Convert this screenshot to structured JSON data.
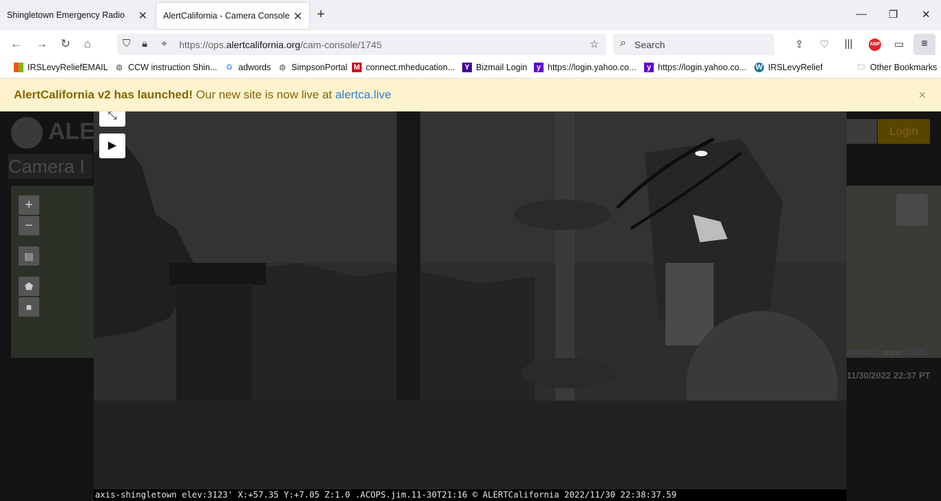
{
  "tabs": [
    {
      "label": "Shingletown Emergency Radio",
      "active": false
    },
    {
      "label": "AlertCalifornia - Camera Console",
      "active": true
    }
  ],
  "address": {
    "prefix": "https://ops.",
    "domain": "alertcalifornia.org",
    "path": "/cam-console/1745"
  },
  "search": {
    "placeholder": "Search"
  },
  "bookmarks": [
    {
      "label": "IRSLevyReliefEMAIL",
      "icon": "windows-icon"
    },
    {
      "label": "CCW instruction Shin...",
      "icon": "globe-icon"
    },
    {
      "label": "adwords",
      "icon": "google-icon"
    },
    {
      "label": "SimpsonPortal",
      "icon": "globe-icon"
    },
    {
      "label": "connect.mheducation...",
      "icon": "mcgraw-hill-icon"
    },
    {
      "label": "Bizmail Login",
      "icon": "yahoo-icon"
    },
    {
      "label": "https://login.yahoo.co...",
      "icon": "yahoo-icon"
    },
    {
      "label": "https://login.yahoo.co...",
      "icon": "yahoo-icon"
    },
    {
      "label": "IRSLevyRelief",
      "icon": "wordpress-icon"
    }
  ],
  "other_bookmarks": "Other Bookmarks",
  "extension_badge": "ABP",
  "banner": {
    "bold": "AlertCalifornia v2 has launched!",
    "text": " Our new site is now live at ",
    "link": "alertca.live",
    "close": "×"
  },
  "background_page": {
    "logo_text": "ALE",
    "heading": "Camera I",
    "login": "Login",
    "map_attribution_link": "reetMap",
    "map_attribution_text": ", under ",
    "map_attribution_link2": "ODbL.",
    "timestamp": "11/30/2022 22:37 PT"
  },
  "camera": {
    "caption": "axis-shingletown elev:3123' X:+57.35 Y:+7.05 Z:1.0 .ACOPS.jim.11-30T21:16 © ALERTCalifornia 2022/11/30 22:38:37.59"
  },
  "colors": {
    "banner_bg": "#fff3cd",
    "banner_text": "#856404",
    "link": "#2f7fd4",
    "abp": "#e0262d"
  }
}
